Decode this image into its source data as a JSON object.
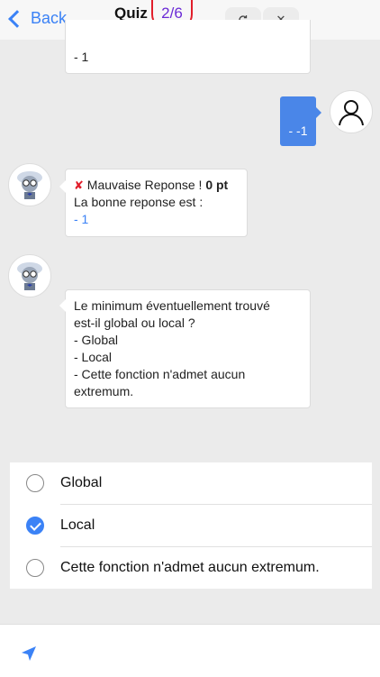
{
  "header": {
    "back_label": "Back",
    "title": "Quiz",
    "counter": "2/6",
    "refresh_icon": "refresh-icon",
    "close_icon": "close-icon"
  },
  "messages": {
    "prev_question": {
      "line1": "- 1"
    },
    "user_answer": "- -1",
    "feedback": {
      "verdict_prefix": "Mauvaise Reponse ! ",
      "verdict_score": "0 pt",
      "line2": "La bonne reponse est :",
      "correct": "- 1"
    },
    "question": {
      "line1": "Le minimum éventuellement trouvé",
      "line2": "est-il global ou local ?",
      "line3": "- Global",
      "line4": "- Local",
      "line5": "- Cette fonction n'admet aucun",
      "line6": "extremum."
    }
  },
  "options": [
    {
      "label": "Global",
      "checked": false
    },
    {
      "label": "Local",
      "checked": true
    },
    {
      "label": "Cette fonction n'admet aucun extremum.",
      "checked": false
    }
  ],
  "colors": {
    "accent": "#3b82f6",
    "user_bubble": "#4a86e8",
    "counter_ring": "#e11d2a",
    "counter_text": "#6b2bd6"
  }
}
